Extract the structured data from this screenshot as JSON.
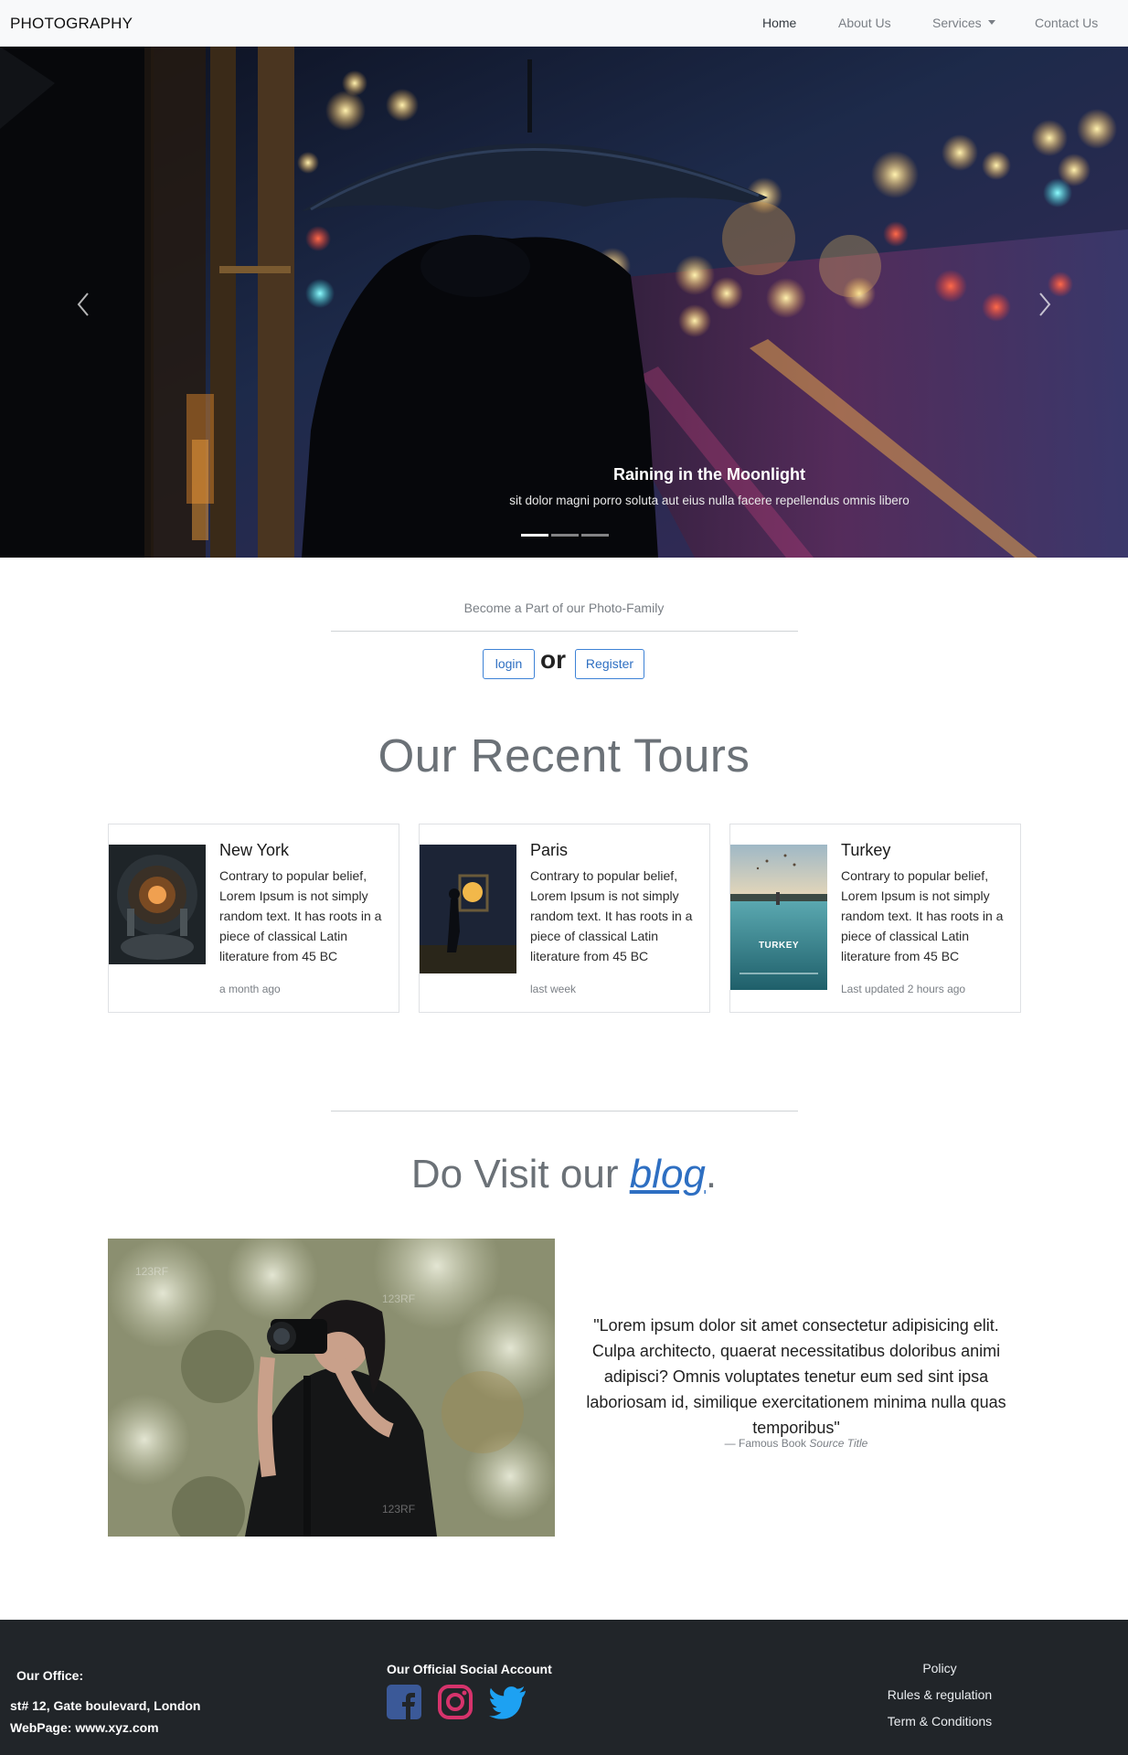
{
  "navbar": {
    "brand": "PHOTOGRAPHY",
    "items": [
      {
        "label": "Home",
        "active": true
      },
      {
        "label": "About Us",
        "active": false
      },
      {
        "label": "Services",
        "active": false,
        "dropdown": true
      },
      {
        "label": "Contact Us",
        "active": false
      }
    ]
  },
  "carousel": {
    "caption_title": "Raining in the Moonlight",
    "caption_text": "sit dolor magni porro soluta aut eius nulla facere repellendus omnis libero",
    "slide_count": 3,
    "active_slide": 1,
    "prev_icon": "chevron-left-icon",
    "next_icon": "chevron-right-icon"
  },
  "join": {
    "tagline": "Become a Part of our Photo-Family",
    "login_label": "login",
    "or_label": "or",
    "register_label": "Register"
  },
  "tours": {
    "heading": "Our Recent Tours",
    "cards": [
      {
        "title": "New York",
        "text": "Contrary to popular belief, Lorem Ipsum is not simply random text. It has roots in a piece of classical Latin literature from 45 BC",
        "meta": "a month ago"
      },
      {
        "title": "Paris",
        "text": "Contrary to popular belief, Lorem Ipsum is not simply random text. It has roots in a piece of classical Latin literature from 45 BC",
        "meta": "last week"
      },
      {
        "title": "Turkey",
        "text": "Contrary to popular belief, Lorem Ipsum is not simply random text. It has roots in a piece of classical Latin literature from 45 BC",
        "meta": "Last updated 2 hours ago",
        "thumb_label": "TURKEY"
      }
    ]
  },
  "blog": {
    "heading_prefix": "Do Visit our ",
    "link_text": "blog",
    "heading_suffix": ".",
    "watermark": "123RF",
    "quote": "\"Lorem ipsum dolor sit amet consectetur adipisicing elit. Culpa architecto, quaerat necessitatibus doloribus animi adipisci? Omnis voluptates tenetur eum sed sint ipsa laboriosam id, similique exercitationem minima nulla quas temporibus\"",
    "source_prefix": "— Famous Book",
    "source_title": "Source Title"
  },
  "footer": {
    "office_title": "Our Office:",
    "address": "st# 12, Gate boulevard, London",
    "webpage": "WebPage: www.xyz.com",
    "social_title": "Our Official Social Account",
    "social": [
      {
        "icon": "facebook-icon",
        "color": "#3b5998"
      },
      {
        "icon": "instagram-icon",
        "color": "#d6336c"
      },
      {
        "icon": "twitter-icon",
        "color": "#1da1f2"
      }
    ],
    "links": [
      "Policy",
      "Rules & regulation",
      "Term & Conditions"
    ]
  },
  "colors": {
    "navbar_bg": "#f8f9fa",
    "primary": "#2e6fc2",
    "footer_bg": "#212529"
  }
}
